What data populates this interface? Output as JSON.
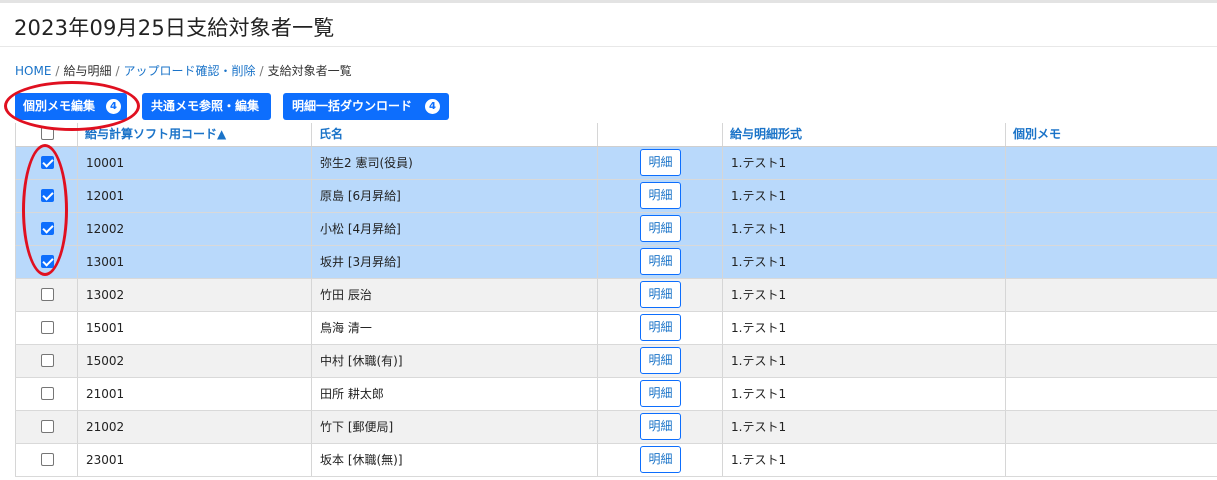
{
  "page": {
    "title": "2023年09月25日支給対象者一覧"
  },
  "breadcrumb": [
    {
      "label": "HOME",
      "link": true
    },
    {
      "label": "給与明細",
      "link": false
    },
    {
      "label": "アップロード確認・削除",
      "link": true
    },
    {
      "label": "支給対象者一覧",
      "link": false
    }
  ],
  "toolbar": {
    "memo_edit_label": "個別メモ編集",
    "memo_edit_count": "4",
    "common_memo_label": "共通メモ参照・編集",
    "bulk_download_label": "明細一括ダウンロード",
    "bulk_download_count": "4"
  },
  "table": {
    "columns": [
      "",
      "給与計算ソフト用コード▲",
      "氏名",
      "",
      "給与明細形式",
      "個別メモ"
    ],
    "detail_label": "明細",
    "rows": [
      {
        "checked": true,
        "code": "10001",
        "name": "弥生2 憲司(役員)",
        "format": "1.テスト1",
        "memo": ""
      },
      {
        "checked": true,
        "code": "12001",
        "name": "原島 [6月昇給]",
        "format": "1.テスト1",
        "memo": ""
      },
      {
        "checked": true,
        "code": "12002",
        "name": "小松 [4月昇給]",
        "format": "1.テスト1",
        "memo": ""
      },
      {
        "checked": true,
        "code": "13001",
        "name": "坂井 [3月昇給]",
        "format": "1.テスト1",
        "memo": ""
      },
      {
        "checked": false,
        "code": "13002",
        "name": "竹田 辰治",
        "format": "1.テスト1",
        "memo": ""
      },
      {
        "checked": false,
        "code": "15001",
        "name": "鳥海 清一",
        "format": "1.テスト1",
        "memo": ""
      },
      {
        "checked": false,
        "code": "15002",
        "name": "中村 [休職(有)]",
        "format": "1.テスト1",
        "memo": ""
      },
      {
        "checked": false,
        "code": "21001",
        "name": "田所 耕太郎",
        "format": "1.テスト1",
        "memo": ""
      },
      {
        "checked": false,
        "code": "21002",
        "name": "竹下 [郵便局]",
        "format": "1.テスト1",
        "memo": ""
      },
      {
        "checked": false,
        "code": "23001",
        "name": "坂本 [休職(無)]",
        "format": "1.テスト1",
        "memo": ""
      }
    ]
  },
  "colors": {
    "accent": "#0d6efd",
    "link": "#1a73c8",
    "selected_row": "#b9d9fb",
    "annotation": "#e01020"
  }
}
